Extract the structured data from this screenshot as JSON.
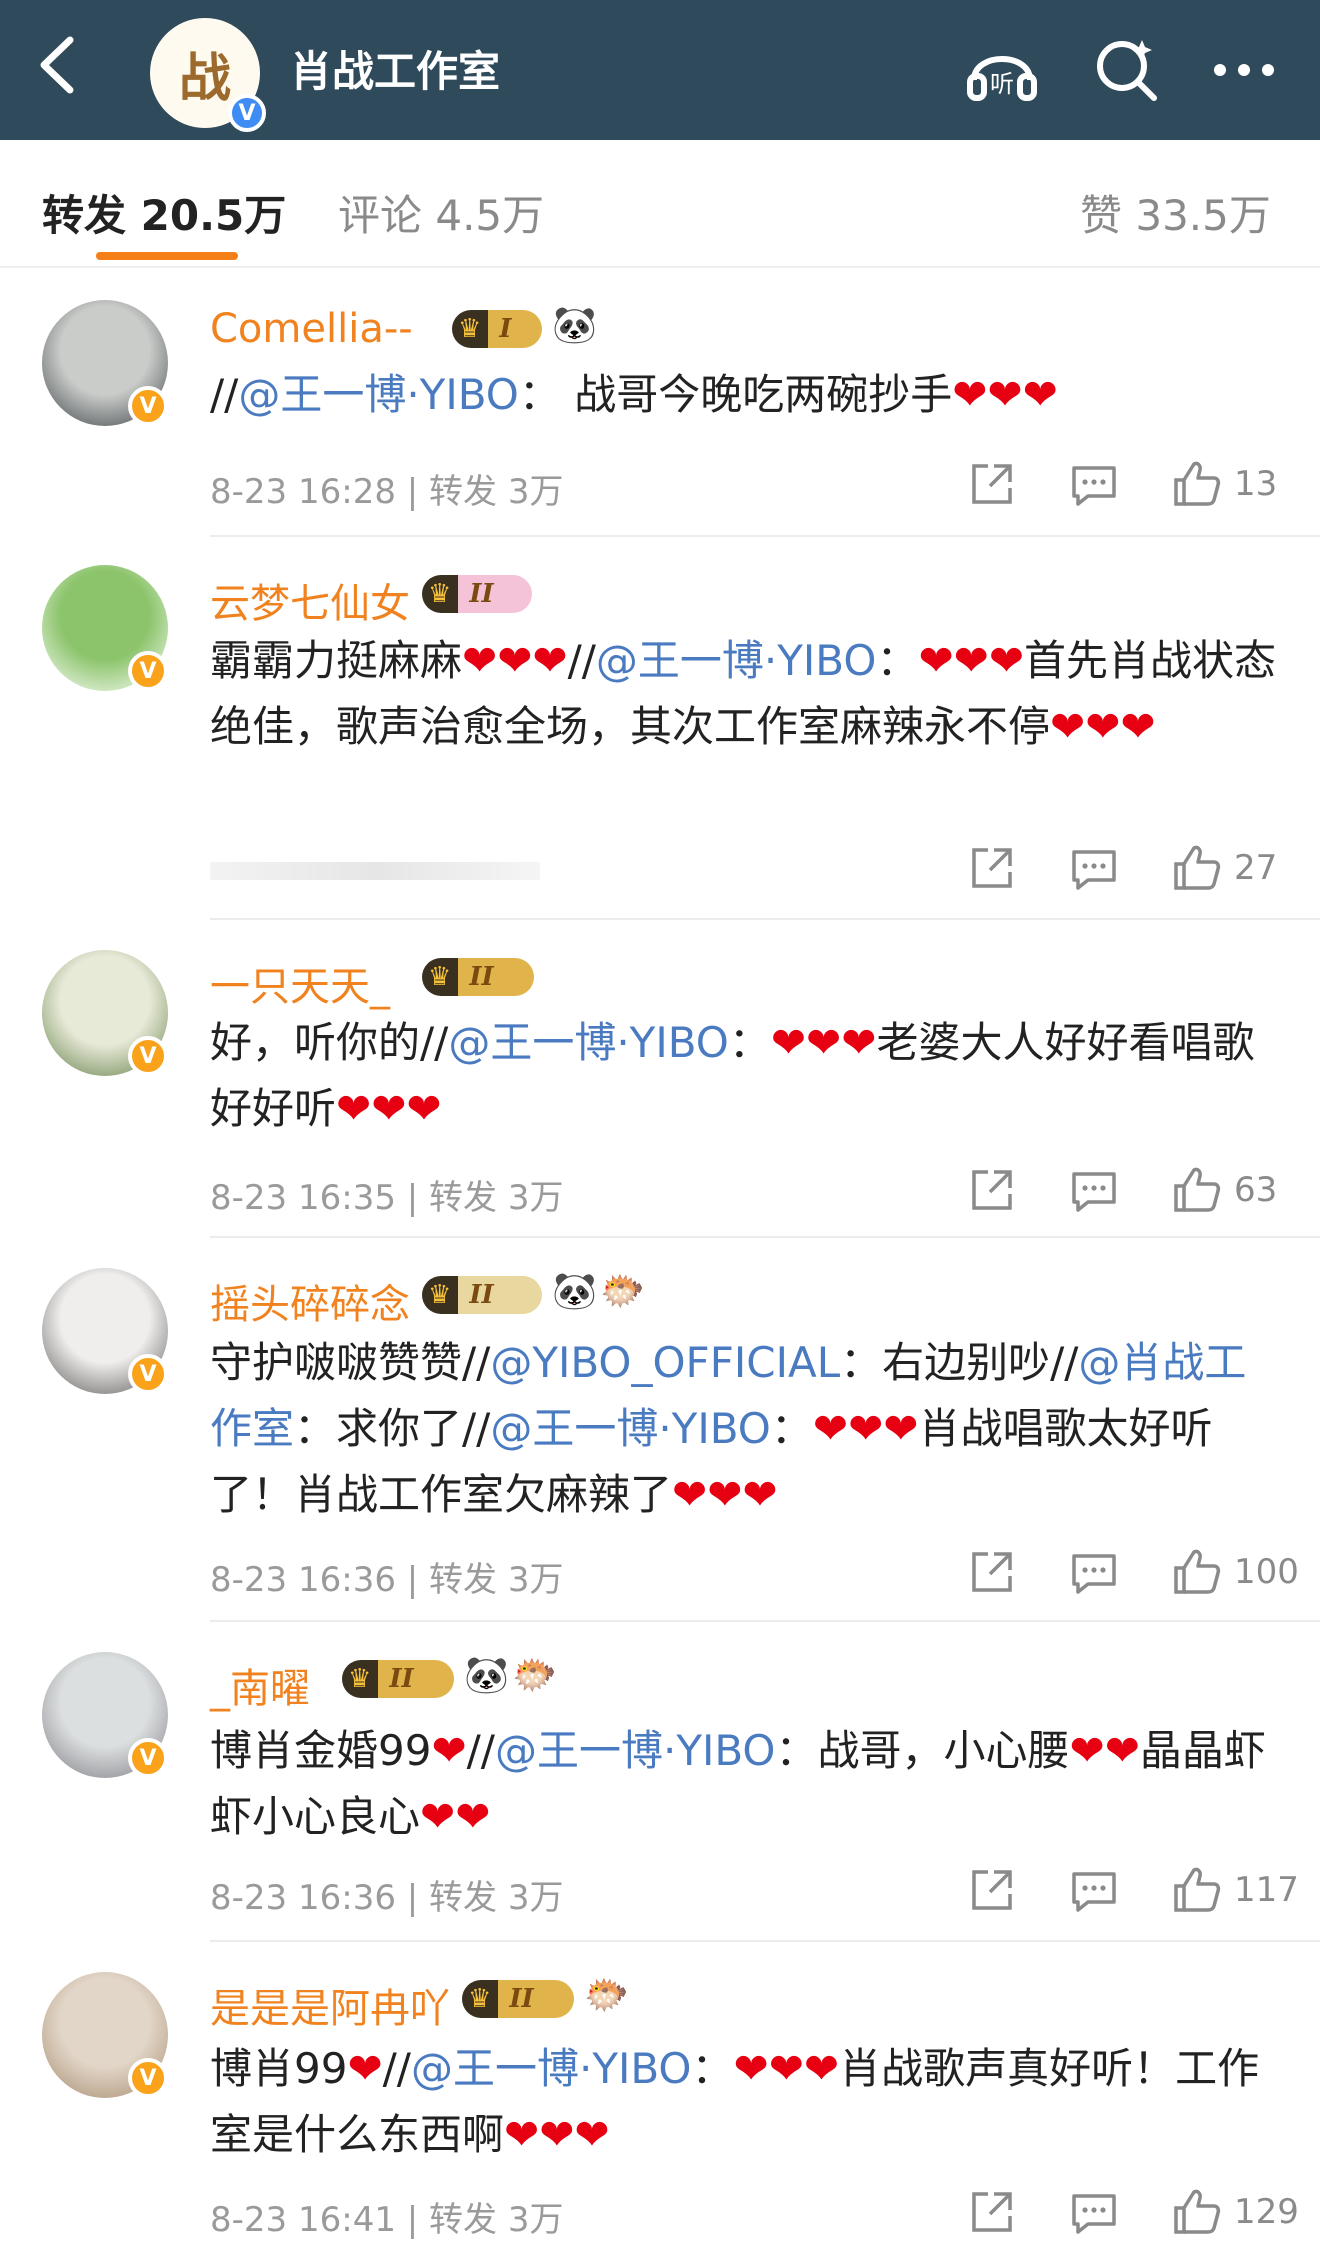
{
  "header": {
    "title": "肖战工作室",
    "logo_glyph": "战",
    "verified": "V"
  },
  "tabs": {
    "repost": "转发 20.5万",
    "comment": "评论 4.5万",
    "like": "赞 33.5万"
  },
  "comments": [
    {
      "name": "Comellia--",
      "badge": "I",
      "parts": [
        [
          "t",
          "//"
        ],
        [
          "m",
          "@王一博·YIBO"
        ],
        [
          "t",
          "：  战哥今晚吃两碗抄手"
        ],
        [
          "h",
          "❤❤❤"
        ]
      ],
      "meta": "8-23 16:28 | 转发 3万",
      "likes": "13"
    },
    {
      "name": "云梦七仙女",
      "badge": "II",
      "parts": [
        [
          "t",
          "霸霸力挺麻麻"
        ],
        [
          "h",
          "❤❤❤"
        ],
        [
          "t",
          "//"
        ],
        [
          "m",
          "@王一博·YIBO"
        ],
        [
          "t",
          "："
        ],
        [
          "h",
          "❤❤❤"
        ],
        [
          "t",
          "首先肖战状态绝佳，歌声治愈全场，其次工作室麻辣永不停"
        ],
        [
          "h",
          "❤❤❤"
        ]
      ],
      "meta": "",
      "likes": "27"
    },
    {
      "name": "一只天天_",
      "badge": "II",
      "parts": [
        [
          "t",
          "好，听你的//"
        ],
        [
          "m",
          "@王一博·YIBO"
        ],
        [
          "t",
          "："
        ],
        [
          "h",
          "❤❤❤"
        ],
        [
          "t",
          "老婆大人好好看唱歌好好听"
        ],
        [
          "h",
          "❤❤❤"
        ]
      ],
      "meta": "8-23 16:35 | 转发 3万",
      "likes": "63"
    },
    {
      "name": "摇头碎碎念",
      "badge": "II",
      "parts": [
        [
          "t",
          "守护啵啵赞赞//"
        ],
        [
          "m",
          "@YIBO_OFFICIAL"
        ],
        [
          "t",
          "：右边别吵//"
        ],
        [
          "m",
          "@肖战工作室"
        ],
        [
          "t",
          "：求你了//"
        ],
        [
          "m",
          "@王一博·YIBO"
        ],
        [
          "t",
          "："
        ],
        [
          "h",
          "❤❤❤"
        ],
        [
          "t",
          "肖战唱歌太好听了！肖战工作室欠麻辣了"
        ],
        [
          "h",
          "❤❤❤"
        ]
      ],
      "meta": "8-23 16:36 | 转发 3万",
      "likes": "100"
    },
    {
      "name": "_南曜",
      "badge": "II",
      "parts": [
        [
          "t",
          "博肖金婚99"
        ],
        [
          "h",
          "❤"
        ],
        [
          "t",
          "//"
        ],
        [
          "m",
          "@王一博·YIBO"
        ],
        [
          "t",
          "：战哥，小心腰"
        ],
        [
          "h",
          "❤❤"
        ],
        [
          "t",
          "晶晶虾虾小心良心"
        ],
        [
          "h",
          "❤❤"
        ]
      ],
      "meta": "8-23 16:36 | 转发 3万",
      "likes": "117"
    },
    {
      "name": "是是是阿冉吖",
      "badge": "II",
      "parts": [
        [
          "t",
          "博肖99"
        ],
        [
          "h",
          "❤"
        ],
        [
          "t",
          "//"
        ],
        [
          "m",
          "@王一博·YIBO"
        ],
        [
          "t",
          "："
        ],
        [
          "h",
          "❤❤❤"
        ],
        [
          "t",
          "肖战歌声真好听！工作室是什么东西啊"
        ],
        [
          "h",
          "❤❤❤"
        ]
      ],
      "meta": "8-23 16:41 | 转发 3万",
      "likes": "129"
    }
  ],
  "icons": {
    "back": "back-arrow-icon",
    "listen": "headphones-icon",
    "search": "search-icon",
    "more": "more-icon",
    "repost": "repost-icon",
    "comment": "comment-icon",
    "like": "like-icon"
  },
  "colors": {
    "header_bg": "#2e4a5b",
    "username": "#f0821f",
    "mention": "#4a7ac0",
    "heart": "#e60012",
    "tab_underline": "#f57f17"
  }
}
